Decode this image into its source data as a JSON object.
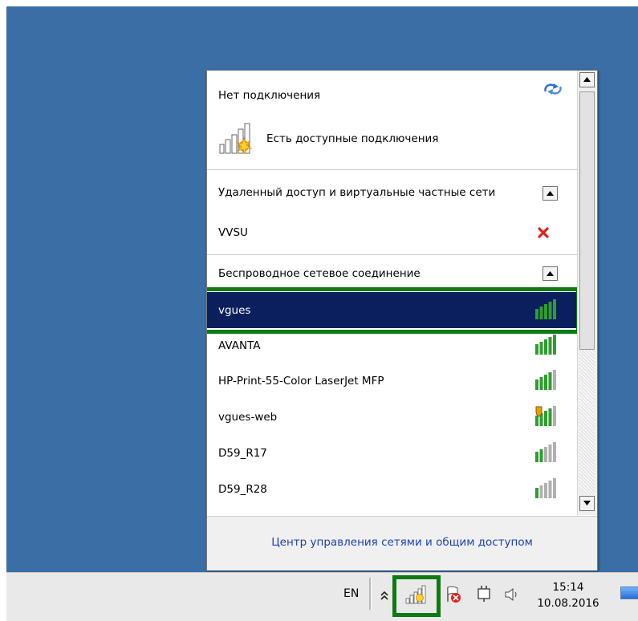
{
  "popup": {
    "status_title": "Нет подключения",
    "status_subtitle": "Есть доступные подключения",
    "vpn_section": {
      "header": "Удаленный доступ и виртуальные частные сети",
      "items": [
        {
          "name": "VVSU",
          "state": "disconnected"
        }
      ]
    },
    "wireless_section": {
      "header": "Беспроводное сетевое соединение",
      "networks": [
        {
          "name": "vgues",
          "signal_bars": 5,
          "selected": true,
          "secured": false
        },
        {
          "name": "AVANTA",
          "signal_bars": 5,
          "selected": false,
          "secured": false
        },
        {
          "name": "HP-Print-55-Color LaserJet MFP",
          "signal_bars": 4,
          "selected": false,
          "secured": false
        },
        {
          "name": "vgues-web",
          "signal_bars": 4,
          "selected": false,
          "secured": true
        },
        {
          "name": "D59_R17",
          "signal_bars": 2,
          "selected": false,
          "secured": false
        },
        {
          "name": "D59_R28",
          "signal_bars": 1,
          "selected": false,
          "secured": false
        }
      ]
    },
    "footer_link": "Центр управления сетями и общим доступом"
  },
  "taskbar": {
    "language": "EN",
    "clock_time": "15:14",
    "clock_date": "10.08.2016"
  },
  "colors": {
    "desktop": "#3a6ea5",
    "selection_bg": "#0b1f5e",
    "highlight_outline": "#0e7a12",
    "signal_green": "#2e9e2e",
    "signal_grey": "#b0b0b0",
    "link": "#1a3fb4",
    "disconnect_x": "#e0201c"
  }
}
